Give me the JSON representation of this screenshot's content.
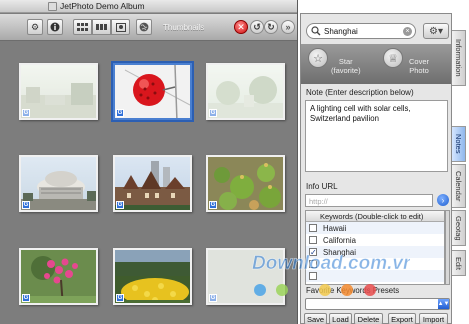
{
  "window": {
    "title": "JetPhoto Demo Album"
  },
  "toolbar": {
    "view_mode_label": "Thumbnails",
    "buttons": [
      "gear-icon",
      "info-icon",
      "grid-view-icon",
      "filmstrip-view-icon",
      "single-view-icon",
      "globe-icon"
    ],
    "delete_glyph": "✕",
    "rotate_left_glyph": "↺",
    "rotate_right_glyph": "↻",
    "forward_glyph": "»"
  },
  "thumbnails": [
    {
      "badge": "G",
      "scene": "street",
      "faded": true,
      "selected": false
    },
    {
      "badge": "G",
      "scene": "red-cell",
      "faded": false,
      "selected": true
    },
    {
      "badge": "G",
      "scene": "trees",
      "faded": true,
      "selected": false
    },
    {
      "badge": "G",
      "scene": "dome",
      "faded": false,
      "selected": false
    },
    {
      "badge": "G",
      "scene": "castle",
      "faded": false,
      "selected": false
    },
    {
      "badge": "G",
      "scene": "cactus",
      "faded": false,
      "selected": false
    },
    {
      "badge": "G",
      "scene": "flowers",
      "faded": false,
      "selected": false
    },
    {
      "badge": "G",
      "scene": "garden",
      "faded": false,
      "selected": false
    },
    {
      "badge": "G",
      "scene": "blank",
      "faded": true,
      "selected": false
    }
  ],
  "inspector": {
    "search_value": "Shanghai",
    "star_label_line1": "Star",
    "star_label_line2": "(favorite)",
    "cover_label_line1": "Cover",
    "cover_label_line2": "Photo",
    "note_label": "Note (Enter description below)",
    "note_text": "A lighting cell with solar cells, Switzerland pavilion",
    "info_url_label": "Info URL",
    "url_placeholder": "http://",
    "keywords_header": "Keywords (Double-click to edit)",
    "keywords": [
      {
        "label": "Hawaii",
        "checked": false
      },
      {
        "label": "California",
        "checked": false
      },
      {
        "label": "Shanghai",
        "checked": true
      },
      {
        "label": "",
        "checked": false
      },
      {
        "label": "",
        "checked": false
      }
    ],
    "presets_label": "Favorite Keywords Presets",
    "buttons": {
      "save": "Save",
      "load": "Load",
      "delete": "Delete",
      "export": "Export",
      "import": "Import"
    }
  },
  "side_tabs": [
    "Information",
    "Notes",
    "Calendar",
    "Geotag",
    "Edit"
  ],
  "active_side_tab": "Notes",
  "watermark": {
    "text": "Download.com.vn",
    "dot_colors": [
      "#4aa3e6",
      "#9bd35a",
      "#f2c94c",
      "#f38a2e",
      "#e84c4c"
    ]
  },
  "colors": {
    "accent": "#2f6fd8",
    "delete": "#d01010"
  }
}
